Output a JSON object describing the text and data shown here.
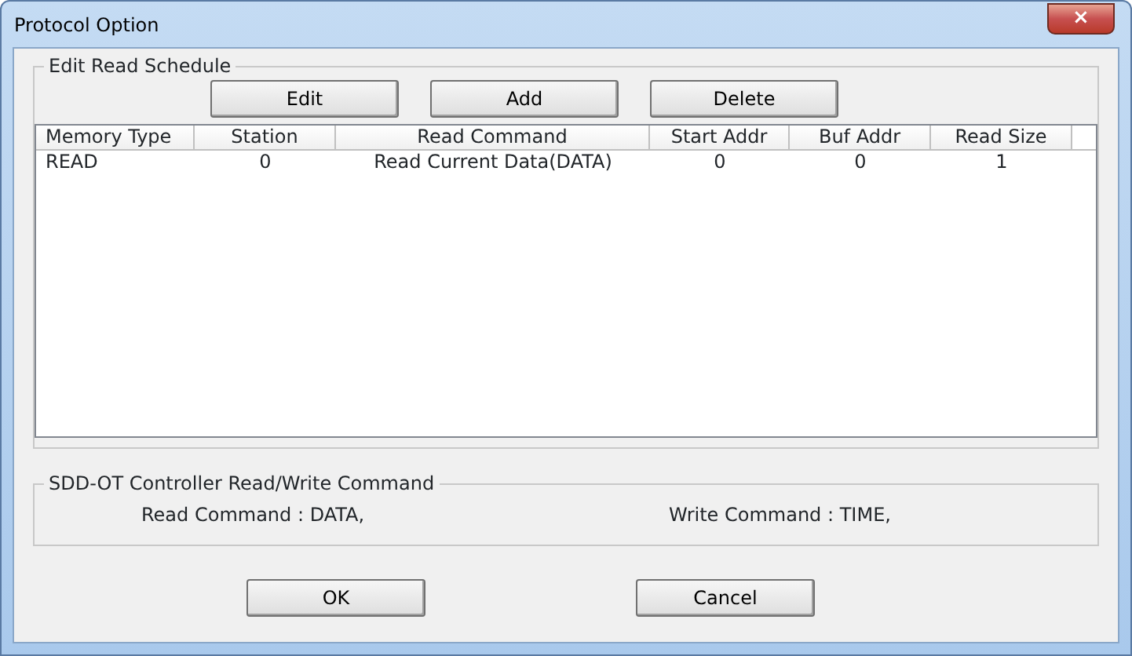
{
  "window": {
    "title": "Protocol Option",
    "close": "×"
  },
  "schedule": {
    "title": "Edit Read Schedule",
    "buttons": [
      "Edit",
      "Add",
      "Delete"
    ],
    "table": {
      "columns": [
        "Memory Type",
        "Station",
        "Read Command",
        "Start Addr",
        "Buf Addr",
        "Read Size"
      ],
      "rows": [
        [
          "READ",
          "0",
          "Read Current Data(DATA)",
          "0",
          "0",
          "1"
        ]
      ]
    }
  },
  "commands": {
    "title": "SDD-OT Controller Read/Write Command",
    "read": "Read Command : DATA,",
    "write": "Write Command : TIME,"
  },
  "buttons": [
    "OK",
    "Cancel"
  ]
}
